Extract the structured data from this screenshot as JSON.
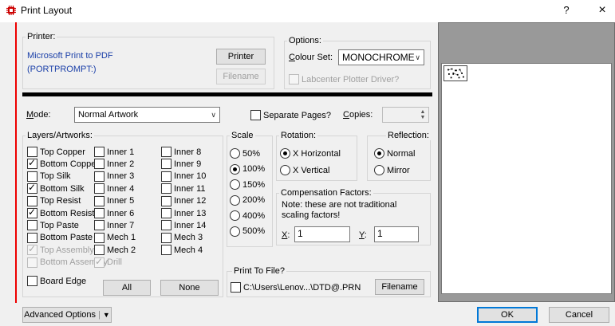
{
  "window": {
    "title": "Print Layout",
    "help": "?",
    "close": "×"
  },
  "printer": {
    "group_label": "Printer:",
    "name": "Microsoft Print to PDF",
    "port": "(PORTPROMPT:)",
    "printer_button": "Printer",
    "filename_button": "Filename"
  },
  "options": {
    "group_label": "Options:",
    "colour_set_label": "Colour Set:",
    "colour_set_value": "MONOCHROME",
    "labcenter_label": "Labcenter Plotter Driver?"
  },
  "mode": {
    "label": "Mode:",
    "value": "Normal Artwork",
    "separate_pages_label": "Separate Pages?",
    "copies_label": "Copies:",
    "copies_value": ""
  },
  "layers": {
    "group_label": "Layers/Artworks:",
    "col1": [
      {
        "label": "Top Copper",
        "checked": false,
        "disabled": false
      },
      {
        "label": "Bottom Copper",
        "checked": true,
        "disabled": false
      },
      {
        "label": "Top Silk",
        "checked": false,
        "disabled": false
      },
      {
        "label": "Bottom Silk",
        "checked": true,
        "disabled": false
      },
      {
        "label": "Top Resist",
        "checked": false,
        "disabled": false
      },
      {
        "label": "Bottom Resist",
        "checked": true,
        "disabled": false
      },
      {
        "label": "Top Paste",
        "checked": false,
        "disabled": false
      },
      {
        "label": "Bottom Paste",
        "checked": false,
        "disabled": false
      },
      {
        "label": "Top Assembly",
        "checked": true,
        "disabled": true
      },
      {
        "label": "Bottom Assembly",
        "checked": false,
        "disabled": true
      }
    ],
    "col2": [
      {
        "label": "Inner 1",
        "checked": false,
        "disabled": false
      },
      {
        "label": "Inner 2",
        "checked": false,
        "disabled": false
      },
      {
        "label": "Inner 3",
        "checked": false,
        "disabled": false
      },
      {
        "label": "Inner 4",
        "checked": false,
        "disabled": false
      },
      {
        "label": "Inner 5",
        "checked": false,
        "disabled": false
      },
      {
        "label": "Inner 6",
        "checked": false,
        "disabled": false
      },
      {
        "label": "Inner 7",
        "checked": false,
        "disabled": false
      },
      {
        "label": "Mech 1",
        "checked": false,
        "disabled": false
      },
      {
        "label": "Mech 2",
        "checked": false,
        "disabled": false
      },
      {
        "label": "Drill",
        "checked": true,
        "disabled": true
      }
    ],
    "col3": [
      {
        "label": "Inner 8",
        "checked": false,
        "disabled": false
      },
      {
        "label": "Inner 9",
        "checked": false,
        "disabled": false
      },
      {
        "label": "Inner 10",
        "checked": false,
        "disabled": false
      },
      {
        "label": "Inner 11",
        "checked": false,
        "disabled": false
      },
      {
        "label": "Inner 12",
        "checked": false,
        "disabled": false
      },
      {
        "label": "Inner 13",
        "checked": false,
        "disabled": false
      },
      {
        "label": "Inner 14",
        "checked": false,
        "disabled": false
      },
      {
        "label": "Mech 3",
        "checked": false,
        "disabled": false
      },
      {
        "label": "Mech 4",
        "checked": false,
        "disabled": false
      }
    ],
    "board_edge_label": "Board Edge",
    "all_button": "All",
    "none_button": "None"
  },
  "scale": {
    "group_label": "Scale",
    "options": [
      "50%",
      "100%",
      "150%",
      "200%",
      "400%",
      "500%"
    ],
    "selected": "100%"
  },
  "rotation": {
    "group_label": "Rotation:",
    "options": [
      "X Horizontal",
      "X Vertical"
    ],
    "selected": "X Horizontal"
  },
  "reflection": {
    "group_label": "Reflection:",
    "options": [
      "Normal",
      "Mirror"
    ],
    "selected": "Normal"
  },
  "compensation": {
    "group_label": "Compensation Factors:",
    "note": "Note: these are not traditional scaling factors!",
    "x_label": "X:",
    "x_value": "1",
    "y_label": "Y:",
    "y_value": "1"
  },
  "print_to_file": {
    "group_label": "Print To File?",
    "path": "C:\\Users\\Lenov...\\DTD@.PRN",
    "filename_button": "Filename"
  },
  "footer": {
    "advanced_options": "Advanced Options",
    "ok": "OK",
    "cancel": "Cancel"
  },
  "colors": {
    "accent": "#0078d7",
    "link_blue": "#1a3fa8",
    "dialog_bg": "#f0f0f0",
    "preview_bg": "#999999",
    "stripe": "#e00000"
  }
}
